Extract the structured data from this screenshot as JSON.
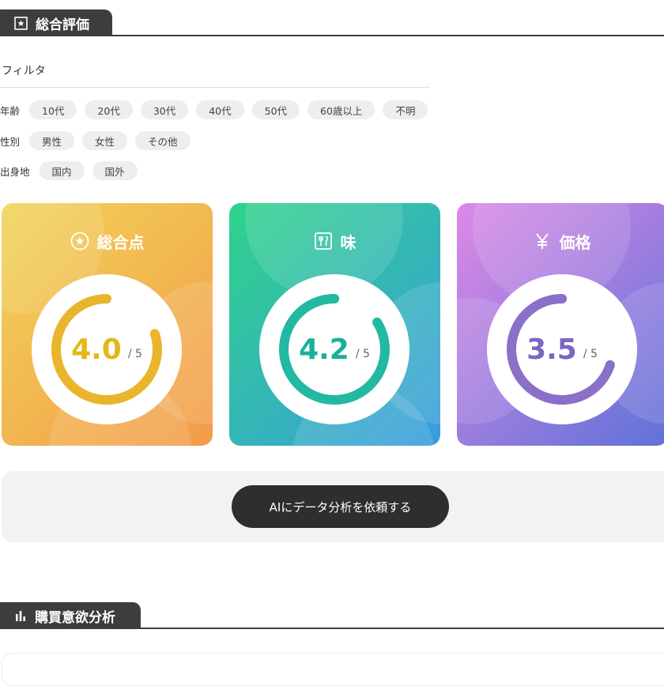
{
  "section_overall": {
    "title": "総合評価"
  },
  "filters": {
    "title": "フィルタ",
    "age": {
      "label": "年齢",
      "options": [
        "10代",
        "20代",
        "30代",
        "40代",
        "50代",
        "60歳以上",
        "不明"
      ]
    },
    "gender": {
      "label": "性別",
      "options": [
        "男性",
        "女性",
        "その他"
      ]
    },
    "origin": {
      "label": "出身地",
      "options": [
        "国内",
        "国外"
      ]
    }
  },
  "score_cards": [
    {
      "title": "総合点",
      "icon": "star-circle-icon",
      "score": "4.0",
      "max": "/ 5",
      "fraction": 0.8,
      "color_from": "#f1d458",
      "color_to": "#f39a4a",
      "accent": "#e9b52c",
      "score_color": "#e3b81a"
    },
    {
      "title": "味",
      "icon": "fork-knife-icon",
      "score": "4.2",
      "max": "/ 5",
      "fraction": 0.84,
      "color_from": "#2fd389",
      "color_to": "#3a9be0",
      "accent": "#22b8a2",
      "score_color": "#19b09a"
    },
    {
      "title": "価格",
      "icon": "yen-icon",
      "score": "3.5",
      "max": "/ 5",
      "fraction": 0.7,
      "color_from": "#dc89e6",
      "color_to": "#5f72d8",
      "accent": "#8a70c8",
      "score_color": "#7b66c0"
    }
  ],
  "ai_button": {
    "label": "AIにデータ分析を依頼する"
  },
  "section_purchase": {
    "title": "購買意欲分析"
  }
}
